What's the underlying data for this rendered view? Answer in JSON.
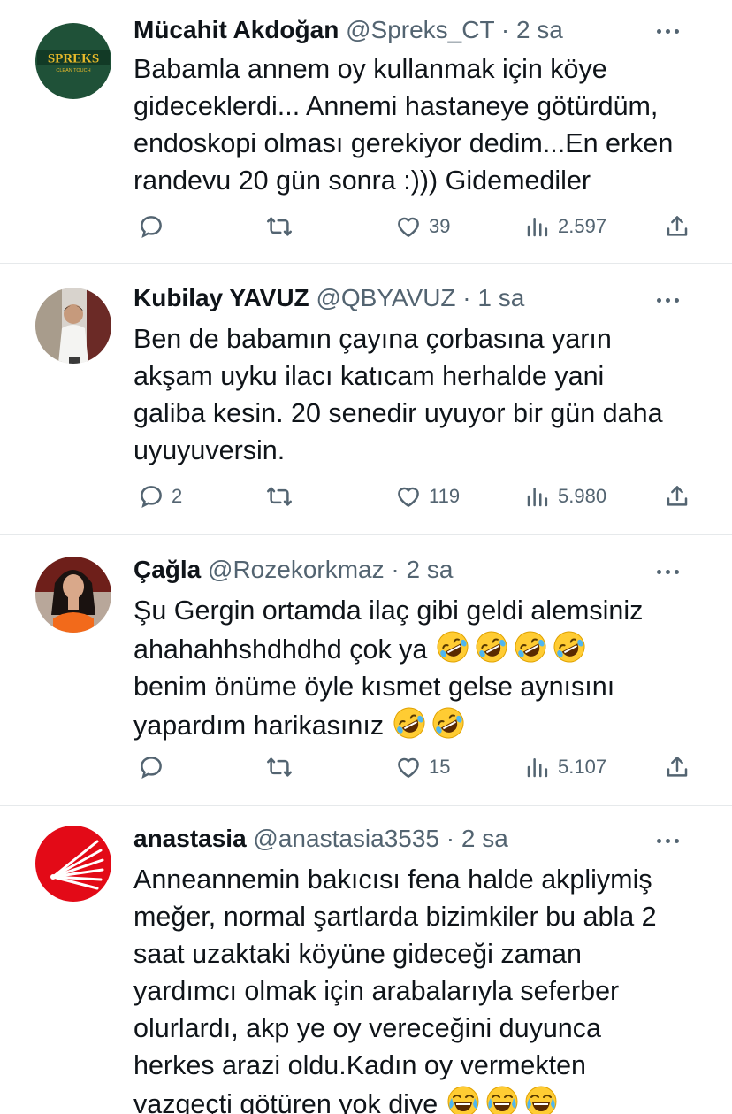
{
  "tweets": [
    {
      "name": "Mücahit Akdoğan",
      "handle": "@Spreks_CT",
      "separator": "·",
      "time": "2 sa",
      "avatar_text": "SPREKS",
      "avatar_subtext": "CLEAN TOUCH",
      "text": "Babamla annem oy kullanmak için köye gideceklerdi... Annemi hastaneye götürdüm, endoskopi olması gerekiyor dedim...En erken randevu 20 gün sonra :))) Gidemediler",
      "replies": "",
      "retweets": "",
      "likes": "39",
      "views": "2.597"
    },
    {
      "name": "Kubilay YAVUZ",
      "handle": "@QBYAVUZ",
      "separator": "·",
      "time": "1 sa",
      "text": "Ben de babamın çayına çorbasına yarın akşam uyku ilacı katıcam herhalde yani galiba kesin. 20 senedir uyuyor bir gün daha uyuyuversin.",
      "replies": "2",
      "retweets": "",
      "likes": "119",
      "views": "5.980"
    },
    {
      "name": "Çağla",
      "handle": "@Rozekorkmaz",
      "separator": "·",
      "time": "2 sa",
      "text_line1": "Şu Gergin ortamda ilaç gibi geldi alemsiniz",
      "text_line2": "ahahahhshdhdhd çok ya",
      "text_line3": "benim önüme öyle kısmet gelse aynısını",
      "text_line4": "yapardım harikasınız",
      "replies": "",
      "retweets": "",
      "likes": "15",
      "views": "5.107"
    },
    {
      "name": "anastasia",
      "handle": "@anastasia3535",
      "separator": "·",
      "time": "2 sa",
      "text": "Anneannemin bakıcısı fena halde akpliymiş meğer, normal şartlarda bizimkiler bu abla 2 saat uzaktaki köyüne gideceği zaman yardımcı olmak için arabalarıyla seferber olurlardı, akp ye oy vereceğini duyunca herkes arazi oldu.Kadın oy vermekten vazgeçti götüren yok diye"
    }
  ],
  "colors": {
    "text": "#0f1419",
    "secondary": "#536471",
    "divider": "#e6e9eb",
    "chp_red": "#e30a17",
    "avatar_green": "#1f5138"
  },
  "icons": [
    "reply-icon",
    "retweet-icon",
    "like-icon",
    "views-icon",
    "share-icon",
    "more-icon",
    "rofl-emoji",
    "joy-emoji"
  ]
}
